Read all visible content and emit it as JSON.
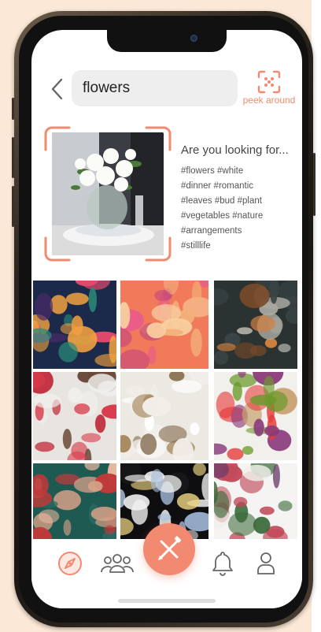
{
  "search": {
    "value": "flowers",
    "back_label": "back",
    "peek_label": "peek around"
  },
  "suggestion": {
    "title": "Are you looking for...",
    "tag_lines": [
      "#flowers #white",
      "#dinner #romantic",
      "#leaves #bud #plant",
      "#vegetables #nature",
      "#arrangements",
      "#stilllife"
    ]
  },
  "grid": {
    "tiles": [
      {
        "name": "abstract-flower-painting",
        "colors": [
          "#1b2a4a",
          "#4a2a6a",
          "#e04a6a",
          "#2a8a7a",
          "#f0a040"
        ]
      },
      {
        "name": "pink-orange-flowers",
        "colors": [
          "#f07a5a",
          "#e85a8a",
          "#f2b07a",
          "#c94a7a",
          "#f8d0a0"
        ]
      },
      {
        "name": "dark-still-life-radio",
        "colors": [
          "#2a3232",
          "#3a4444",
          "#7a4a2a",
          "#d08040",
          "#a8a8a0"
        ]
      },
      {
        "name": "woman-red-flowers",
        "colors": [
          "#e8e4e0",
          "#d83a4a",
          "#6a4a3a",
          "#f0f0ee",
          "#c02a3a"
        ]
      },
      {
        "name": "dried-flowers-vase",
        "colors": [
          "#ece8e2",
          "#f2efea",
          "#a88a60",
          "#ffffff",
          "#7a6040"
        ]
      },
      {
        "name": "vegetables-bag",
        "colors": [
          "#f2f0ec",
          "#e63a3a",
          "#6a9a2a",
          "#8a3a7a",
          "#c8a070"
        ]
      },
      {
        "name": "hand-painted-nails",
        "colors": [
          "#1e5a52",
          "#2a6a62",
          "#d4a088",
          "#c03a3a",
          "#e8b8a0"
        ]
      },
      {
        "name": "dark-hand-flowers",
        "colors": [
          "#0e0e10",
          "#1a1a1e",
          "#e8d080",
          "#a8c0e0",
          "#f0f0f0"
        ]
      },
      {
        "name": "scattered-flowers-white",
        "colors": [
          "#f6f4f2",
          "#f0eeea",
          "#c04a5a",
          "#3a6a3a",
          "#6a3a6a"
        ]
      }
    ]
  },
  "nav": {
    "items": [
      {
        "name": "explore",
        "icon": "compass-icon",
        "active": true
      },
      {
        "name": "community",
        "icon": "people-icon",
        "active": false
      },
      {
        "name": "create",
        "icon": "pencil-brush-icon",
        "active": false
      },
      {
        "name": "notifications",
        "icon": "bell-icon",
        "active": false
      },
      {
        "name": "profile",
        "icon": "user-icon",
        "active": false
      }
    ]
  },
  "colors": {
    "accent": "#f28a72",
    "background": "#fce8d6",
    "search_bg": "#eeeeee"
  }
}
